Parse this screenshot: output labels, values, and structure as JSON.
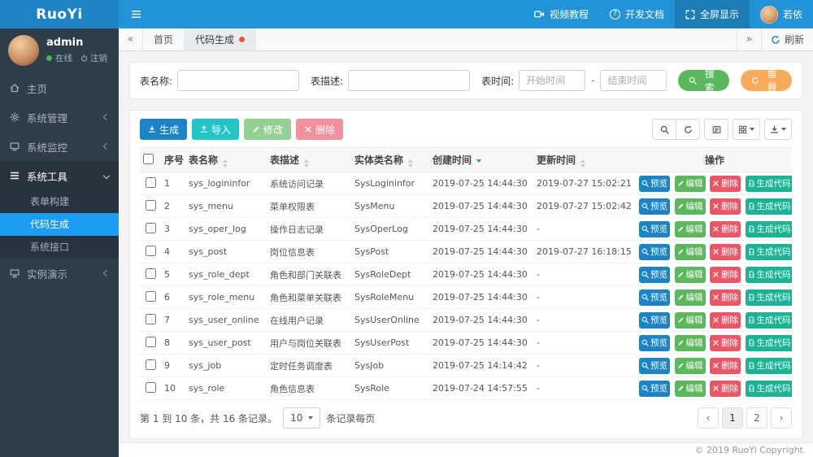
{
  "colors": {
    "navbar_bg": "#2193d6",
    "brand_bg": "#1d83c2",
    "sidebar_bg": "#2e3d49",
    "submenu_bg": "#27333e",
    "active_menu_bg": "#1d9cf4",
    "sort_active": "#2d8cf0",
    "tab_dot": "#e9573f",
    "online_dot": "#46b84b"
  },
  "header": {
    "brand": "RuoYi",
    "nav": [
      {
        "label": "视频教程",
        "icon": "video-icon"
      },
      {
        "label": "开发文档",
        "icon": "question-circle-icon",
        "icon_glyph": "?"
      },
      {
        "label": "全屏显示",
        "icon": "fullscreen-icon",
        "active": true
      },
      {
        "label": "若依",
        "icon": "user-avatar"
      }
    ]
  },
  "sidebar": {
    "user": {
      "name": "admin",
      "status": "在线",
      "logout": "注销"
    },
    "menu": [
      {
        "label": "主页",
        "icon": "home-icon"
      },
      {
        "label": "系统管理",
        "icon": "gear-icon",
        "has_children": true
      },
      {
        "label": "系统监控",
        "icon": "monitor-icon",
        "has_children": true
      },
      {
        "label": "系统工具",
        "icon": "list-icon",
        "has_children": true,
        "expanded": true,
        "children": [
          {
            "label": "表单构建"
          },
          {
            "label": "代码生成",
            "active": true
          },
          {
            "label": "系统接口"
          }
        ]
      },
      {
        "label": "实例演示",
        "icon": "desktop-icon",
        "has_children": true
      }
    ]
  },
  "tabbar": {
    "scroll_left_glyph": "«",
    "scroll_right_glyph": "»",
    "tabs": [
      {
        "label": "首页"
      },
      {
        "label": "代码生成",
        "active": true
      }
    ],
    "refresh_label": "刷新"
  },
  "search": {
    "table_name_label": "表名称:",
    "table_desc_label": "表描述:",
    "table_time_label": "表时间:",
    "start_placeholder": "开始时间",
    "end_placeholder": "结束时间",
    "range_separator": "-",
    "search_button": {
      "label": "搜索",
      "color": "#5bb75b"
    },
    "reset_button": {
      "label": "重置",
      "color": "#f8ac59"
    }
  },
  "toolbar": {
    "buttons": [
      {
        "label": "生成",
        "color": "#1c84c6",
        "icon": "download-icon",
        "disabled": false
      },
      {
        "label": "导入",
        "color": "#23c6c8",
        "icon": "upload-icon",
        "disabled": false
      },
      {
        "label": "修改",
        "color": "#5cb85c",
        "icon": "edit-icon",
        "disabled": true
      },
      {
        "label": "删除",
        "color": "#ed5565",
        "icon": "close-icon",
        "disabled": true
      }
    ],
    "right_tools": [
      "search-icon",
      "refresh-icon",
      "card-view-icon",
      "columns-icon",
      "export-icon"
    ]
  },
  "table": {
    "columns": [
      {
        "label": "序号",
        "sortable": false
      },
      {
        "label": "表名称",
        "sortable": true
      },
      {
        "label": "表描述",
        "sortable": true
      },
      {
        "label": "实体类名称",
        "sortable": true
      },
      {
        "label": "创建时间",
        "sortable": true,
        "sorted": "desc"
      },
      {
        "label": "更新时间",
        "sortable": true
      },
      {
        "label": "操作",
        "sortable": false
      }
    ],
    "rows": [
      {
        "no": "1",
        "name": "sys_logininfor",
        "desc": "系统访问记录",
        "entity": "SysLogininfor",
        "created": "2019-07-25 14:44:30",
        "updated": "2019-07-27 15:02:21"
      },
      {
        "no": "2",
        "name": "sys_menu",
        "desc": "菜单权限表",
        "entity": "SysMenu",
        "created": "2019-07-25 14:44:30",
        "updated": "2019-07-27 15:02:42"
      },
      {
        "no": "3",
        "name": "sys_oper_log",
        "desc": "操作日志记录",
        "entity": "SysOperLog",
        "created": "2019-07-25 14:44:30",
        "updated": "-"
      },
      {
        "no": "4",
        "name": "sys_post",
        "desc": "岗位信息表",
        "entity": "SysPost",
        "created": "2019-07-25 14:44:30",
        "updated": "2019-07-27 16:18:15"
      },
      {
        "no": "5",
        "name": "sys_role_dept",
        "desc": "角色和部门关联表",
        "entity": "SysRoleDept",
        "created": "2019-07-25 14:44:30",
        "updated": "-"
      },
      {
        "no": "6",
        "name": "sys_role_menu",
        "desc": "角色和菜单关联表",
        "entity": "SysRoleMenu",
        "created": "2019-07-25 14:44:30",
        "updated": "-"
      },
      {
        "no": "7",
        "name": "sys_user_online",
        "desc": "在线用户记录",
        "entity": "SysUserOnline",
        "created": "2019-07-25 14:44:30",
        "updated": "-"
      },
      {
        "no": "8",
        "name": "sys_user_post",
        "desc": "用户与岗位关联表",
        "entity": "SysUserPost",
        "created": "2019-07-25 14:44:30",
        "updated": "-"
      },
      {
        "no": "9",
        "name": "sys_job",
        "desc": "定时任务调度表",
        "entity": "SysJob",
        "created": "2019-07-25 14:14:42",
        "updated": "-"
      },
      {
        "no": "10",
        "name": "sys_role",
        "desc": "角色信息表",
        "entity": "SysRole",
        "created": "2019-07-24 14:57:55",
        "updated": "-"
      }
    ],
    "row_actions": [
      {
        "label": "预览",
        "color": "#1c84c6",
        "icon": "search-icon"
      },
      {
        "label": "编辑",
        "color": "#5cb85c",
        "icon": "edit-icon"
      },
      {
        "label": "删除",
        "color": "#ed5565",
        "icon": "close-icon"
      },
      {
        "label": "生成代码",
        "color": "#1ab394",
        "icon": "file-code-icon"
      }
    ]
  },
  "pagination": {
    "info": "第 1 到 10 条，共 16 条记录。",
    "page_size": "10",
    "per_page_suffix": "条记录每页",
    "prev_glyph": "‹",
    "pages": [
      "1",
      "2"
    ],
    "next_glyph": "›",
    "active_page": "1"
  },
  "footer": {
    "copyright": "© 2019 RuoYi Copyright"
  }
}
